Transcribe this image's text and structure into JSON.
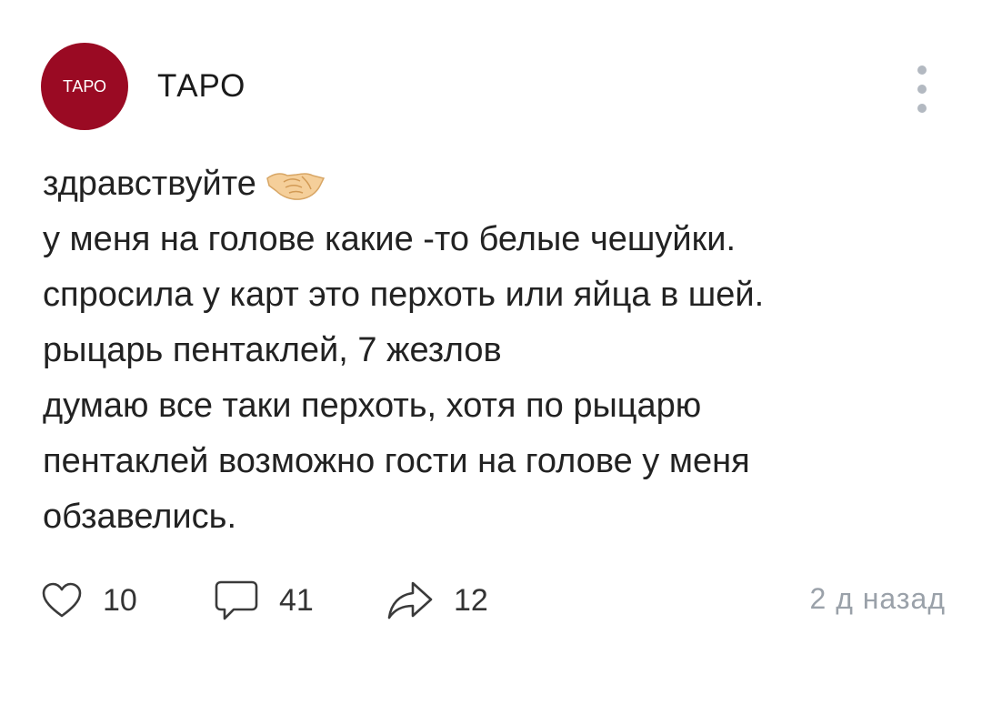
{
  "post": {
    "avatar_text": "ТАРО",
    "author": "ТАРО",
    "menu_icon": "more-vertical-icon",
    "lines": [
      "здравствуйте",
      "у меня на голове какие -то белые чешуйки.",
      "спросила у карт это перхоть или яйца в шей.",
      "рыцарь пентаклей, 7 жезлов",
      "думаю все таки перхоть, хотя по рыцарю",
      "пентаклей возможно гости на голове у меня",
      "обзавелись."
    ],
    "emoji": "handshake-icon"
  },
  "actions": {
    "likes": "10",
    "comments": "41",
    "shares": "12"
  },
  "timestamp": "2 д назад",
  "colors": {
    "avatar_bg": "#9a0a23",
    "muted": "#9aa1a9"
  }
}
